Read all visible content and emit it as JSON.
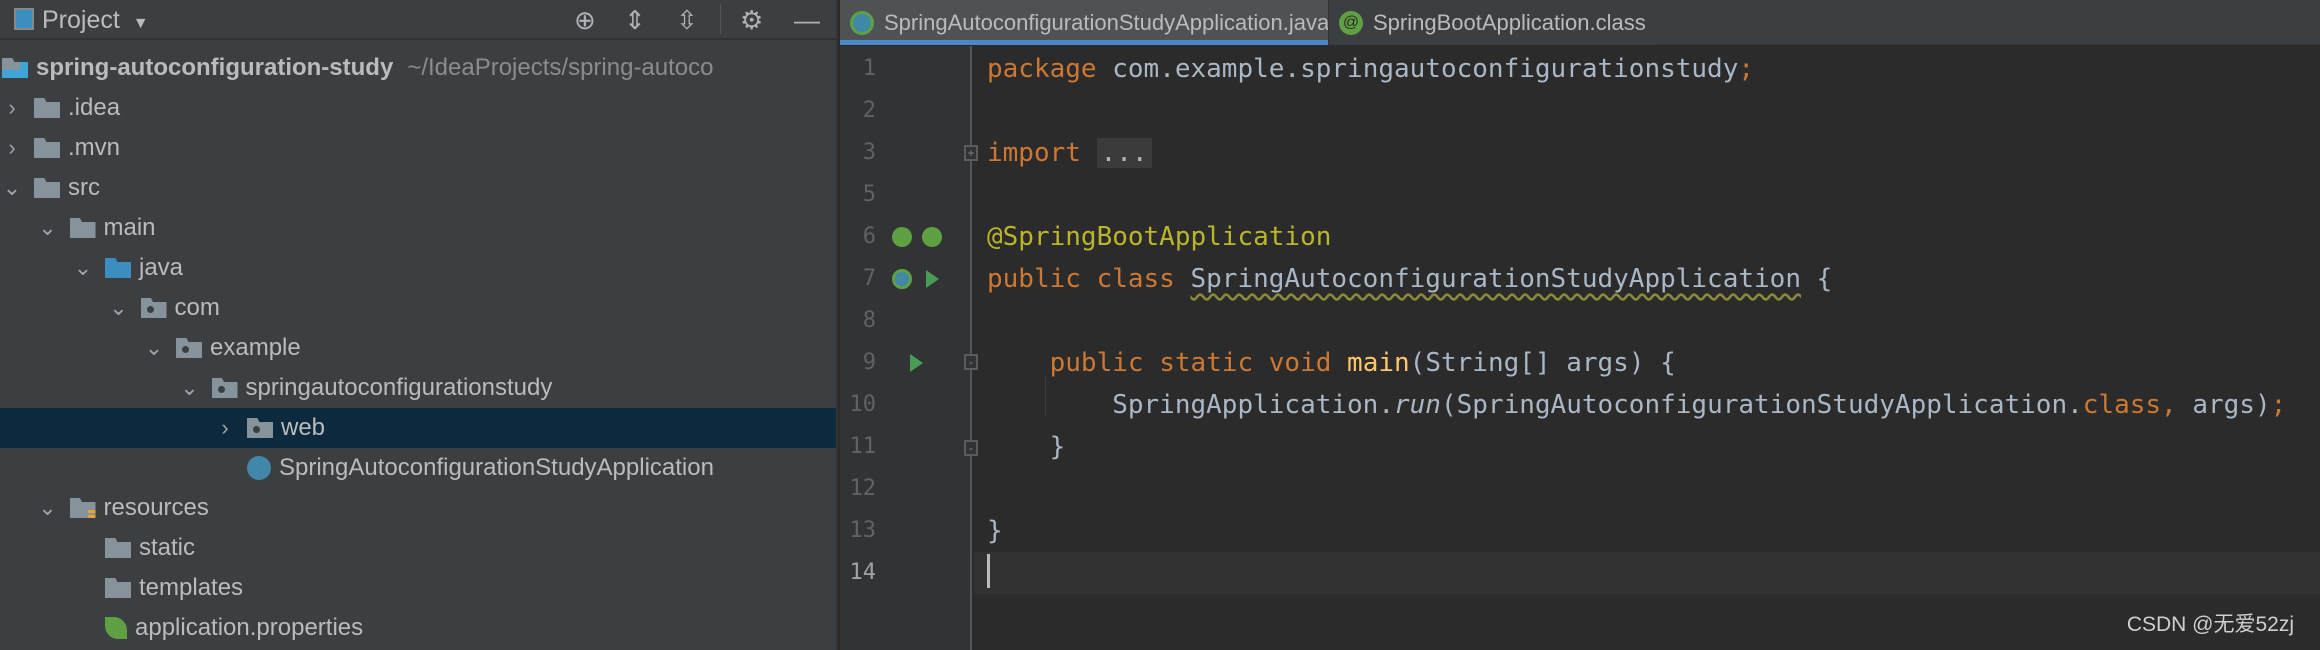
{
  "project_panel": {
    "title": "Project",
    "toolbar_icons": [
      "locate-icon",
      "expand-all-icon",
      "collapse-all-icon",
      "gear-icon",
      "minimize-icon"
    ],
    "tree": [
      {
        "label": "spring-autoconfiguration-study",
        "path": "~/IdeaProjects/spring-autoco",
        "level": 0,
        "chevron": "",
        "icon": "module",
        "bold": true
      },
      {
        "label": ".idea",
        "level": 1,
        "chevron": "right",
        "icon": "folder"
      },
      {
        "label": ".mvn",
        "level": 1,
        "chevron": "right",
        "icon": "folder"
      },
      {
        "label": "src",
        "level": 1,
        "chevron": "down",
        "icon": "folder"
      },
      {
        "label": "main",
        "level": 2,
        "chevron": "down",
        "icon": "folder"
      },
      {
        "label": "java",
        "level": 3,
        "chevron": "down",
        "icon": "source-folder"
      },
      {
        "label": "com",
        "level": 4,
        "chevron": "down",
        "icon": "package"
      },
      {
        "label": "example",
        "level": 5,
        "chevron": "down",
        "icon": "package"
      },
      {
        "label": "springautoconfigurationstudy",
        "level": 6,
        "chevron": "down",
        "icon": "package"
      },
      {
        "label": "web",
        "level": 7,
        "chevron": "right",
        "icon": "package",
        "selected": true
      },
      {
        "label": "SpringAutoconfigurationStudyApplication",
        "level": 7,
        "chevron": "",
        "icon": "spring-boot-class"
      },
      {
        "label": "resources",
        "level": 2,
        "chevron": "down",
        "icon": "resources-folder"
      },
      {
        "label": "static",
        "level": 3,
        "chevron": "",
        "icon": "folder"
      },
      {
        "label": "templates",
        "level": 3,
        "chevron": "",
        "icon": "folder"
      },
      {
        "label": "application.properties",
        "level": 3,
        "chevron": "",
        "icon": "spring-properties"
      }
    ]
  },
  "tabs": [
    {
      "label": "SpringAutoconfigurationStudyApplication.java",
      "active": true,
      "close": "×"
    },
    {
      "label": "SpringBootApplication.class",
      "active": false
    }
  ],
  "editor": {
    "lines": [
      {
        "n": "1",
        "tokens": [
          [
            "kw",
            "package "
          ],
          [
            "",
            "com.example.springautoconfigurationstudy"
          ],
          [
            "kw",
            ";"
          ]
        ]
      },
      {
        "n": "2",
        "tokens": []
      },
      {
        "n": "3",
        "tokens": [
          [
            "kw",
            "import "
          ],
          [
            "fold",
            "..."
          ]
        ]
      },
      {
        "n": "5",
        "tokens": []
      },
      {
        "n": "6",
        "tokens": [
          [
            "ann",
            "@SpringBootApplication"
          ]
        ]
      },
      {
        "n": "7",
        "tokens": [
          [
            "kw",
            "public class "
          ],
          [
            "sq",
            "SpringAutoconfigurationStudyApplication"
          ],
          [
            "",
            " {"
          ]
        ]
      },
      {
        "n": "8",
        "tokens": []
      },
      {
        "n": "9",
        "tokens": [
          [
            "",
            "    "
          ],
          [
            "kw",
            "public static void "
          ],
          [
            "fn",
            "main"
          ],
          [
            "",
            "(String[] args) {"
          ]
        ]
      },
      {
        "n": "10",
        "tokens": [
          [
            "",
            "        SpringApplication."
          ],
          [
            "it",
            "run"
          ],
          [
            "",
            "(SpringAutoconfigurationStudyApplication."
          ],
          [
            "kw",
            "class, "
          ],
          [
            "",
            "args)"
          ],
          [
            "kw",
            ";"
          ]
        ]
      },
      {
        "n": "11",
        "tokens": [
          [
            "",
            "    }"
          ]
        ]
      },
      {
        "n": "12",
        "tokens": []
      },
      {
        "n": "13",
        "tokens": [
          [
            "",
            "}"
          ]
        ]
      },
      {
        "n": "14",
        "tokens": [],
        "current": true
      }
    ]
  },
  "watermark": "CSDN @无爱52zj",
  "colors": {
    "keyword": "#cc7832",
    "annotation": "#bbb529",
    "method": "#ffc66d",
    "text": "#a9b7c6",
    "selection": "#0d293e",
    "tab_accent": "#4a88c7"
  }
}
